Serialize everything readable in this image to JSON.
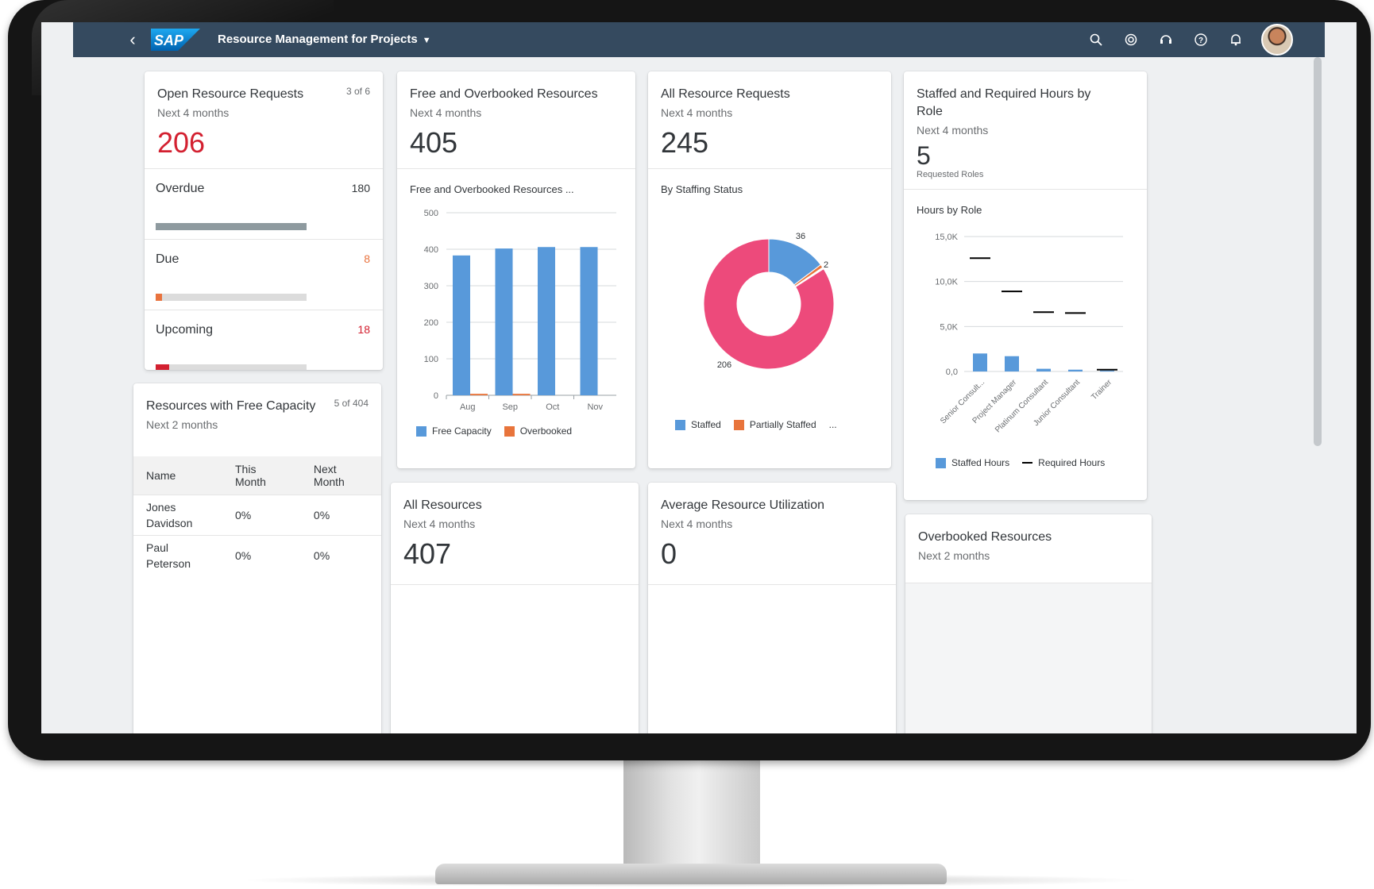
{
  "shell": {
    "title": "Resource Management for Projects",
    "logo_text": "SAP",
    "actions": [
      "search-icon",
      "copilot-icon",
      "support-icon",
      "help-icon",
      "notification-icon"
    ],
    "brand_color": "#354a5f"
  },
  "open_requests": {
    "title": "Open Resource Requests",
    "count": "3 of 6",
    "subtitle": "Next 4 months",
    "kpi": "206",
    "kpi_color": "#d32030",
    "rows": [
      {
        "label": "Overdue",
        "value": "180",
        "fill": 1.0,
        "color": "#8e9a9f",
        "value_color": "#32363a"
      },
      {
        "label": "Due",
        "value": "8",
        "fill": 0.04,
        "color": "#e9733e",
        "value_color": "#e9733e"
      },
      {
        "label": "Upcoming",
        "value": "18",
        "fill": 0.09,
        "color": "#d32030",
        "value_color": "#d32030"
      }
    ]
  },
  "free_capacity": {
    "title": "Resources with Free Capacity",
    "count": "5 of 404",
    "subtitle": "Next 2 months",
    "columns": [
      "Name",
      "This Month",
      "Next Month"
    ],
    "rows": [
      {
        "name": "Jones Davidson",
        "this_month": "0%",
        "next_month": "0%"
      },
      {
        "name": "Paul Peterson",
        "this_month": "0%",
        "next_month": "0%"
      }
    ]
  },
  "free_overbooked": {
    "title": "Free and Overbooked Resources",
    "subtitle": "Next 4 months",
    "kpi": "405",
    "chart_title": "Free and Overbooked Resources ...",
    "legend": [
      "Free Capacity",
      "Overbooked"
    ],
    "colors": [
      "#5899da",
      "#e8743b"
    ]
  },
  "all_requests": {
    "title": "All Resource Requests",
    "subtitle": "Next 4 months",
    "kpi": "245",
    "chart_title": "By Staffing Status",
    "legend": [
      "Staffed",
      "Partially Staffed",
      "..."
    ],
    "colors": [
      "#5899da",
      "#e8743b",
      "#ed4a7b"
    ]
  },
  "hours_by_role": {
    "title": "Staffed and Required Hours by Role",
    "subtitle": "Next 4 months",
    "kpi": "5",
    "kpi_caption": "Requested Roles",
    "chart_title": "Hours by Role",
    "legend": [
      "Staffed Hours",
      "Required Hours"
    ]
  },
  "all_resources": {
    "title": "All Resources",
    "subtitle": "Next 4 months",
    "kpi": "407"
  },
  "utilization": {
    "title": "Average Resource Utilization",
    "subtitle": "Next 4 months",
    "kpi": "0"
  },
  "overbooked": {
    "title": "Overbooked Resources",
    "subtitle": "Next 2 months"
  },
  "chart_data": [
    {
      "type": "bar",
      "title": "Free and Overbooked Resources ...",
      "categories": [
        "Aug",
        "Sep",
        "Oct",
        "Nov"
      ],
      "series": [
        {
          "name": "Free Capacity",
          "values": [
            383,
            402,
            406,
            406
          ]
        },
        {
          "name": "Overbooked",
          "values": [
            4,
            4,
            0,
            0
          ]
        }
      ],
      "ylim": [
        0,
        500
      ],
      "yticks": [
        0,
        100,
        200,
        300,
        400,
        500
      ],
      "grid": true,
      "legend": "bottom"
    },
    {
      "type": "pie",
      "title": "By Staffing Status",
      "donut": true,
      "slices": [
        {
          "name": "Staffed",
          "value": 36
        },
        {
          "name": "Partially Staffed",
          "value": 2
        },
        {
          "name": "...",
          "value": 1
        },
        {
          "name": "",
          "value": 206
        }
      ],
      "labels": [
        "36",
        "2",
        "206"
      ],
      "legend": "bottom"
    },
    {
      "type": "bar",
      "title": "Hours by Role",
      "categories": [
        "Senior Consult...",
        "Project Manager",
        "Platinum Consultant",
        "Junior Consultant",
        "Trainer"
      ],
      "series": [
        {
          "name": "Staffed Hours",
          "values": [
            2000,
            1700,
            300,
            200,
            100
          ]
        },
        {
          "name": "Required Hours",
          "values": [
            12600,
            8900,
            6600,
            6500,
            200
          ]
        }
      ],
      "ylim": [
        0,
        15000
      ],
      "yticks": [
        "0,0",
        "5,0K",
        "10,0K",
        "15,0K"
      ],
      "grid": true,
      "legend": "bottom"
    }
  ]
}
